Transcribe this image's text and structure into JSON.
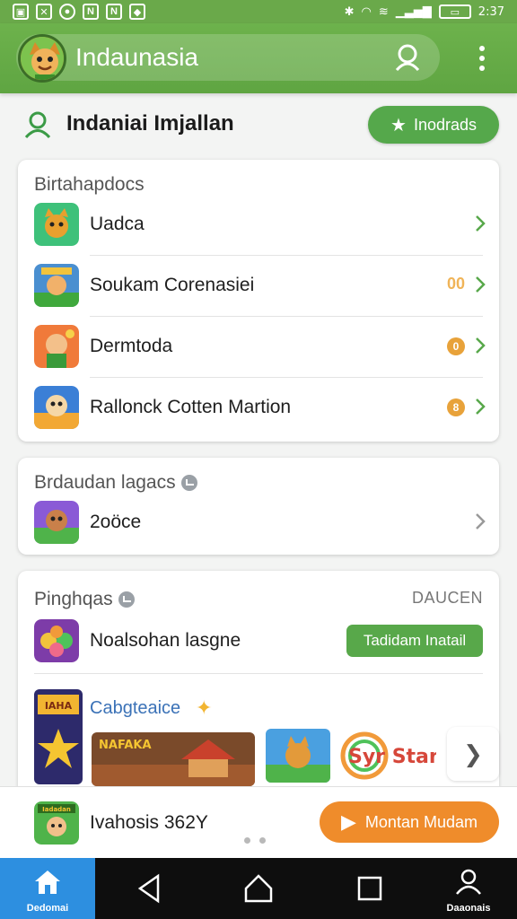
{
  "status_bar": {
    "time": "2:37",
    "left_icons": [
      "screenshot-icon",
      "x-icon",
      "circle-icon",
      "n-icon",
      "n-icon",
      "image-icon"
    ],
    "right_icons": [
      "bluetooth-icon",
      "wifi-icon",
      "signal-icon",
      "battery-icon"
    ]
  },
  "app_bar": {
    "title": "Indaunasia"
  },
  "header": {
    "title": "Indaniai Imjallan",
    "upgrade_label": "Inodrads"
  },
  "card1": {
    "title": "Birtahapdocs",
    "items": [
      {
        "label": "Uadca"
      },
      {
        "label": "Soukam Corenasiei",
        "badge": "00"
      },
      {
        "label": "Dermtoda",
        "badge": "0"
      },
      {
        "label": "Rallonck Cotten Martion",
        "badge": "8"
      }
    ]
  },
  "card2": {
    "title": "Brdaudan lagacs",
    "items": [
      {
        "label": "2oöce"
      }
    ]
  },
  "card3": {
    "title": "Pinghqas",
    "side_label": "DAUCEN",
    "item_label": "Noalsohan lasgne",
    "install_label": "Tadidam Inatail",
    "promo_title": "Cabgteaice",
    "promo_text_tile": "Syr Stan",
    "banner_text": "NAFAKA",
    "poster_text": "IAHA"
  },
  "bottom_promo": {
    "label": "Ivahosis 362Y",
    "button_label": "Montan Mudam",
    "thumb_text": "Iadadan"
  },
  "nav": {
    "home_label": "Dedomai",
    "profile_label": "Daaonais"
  },
  "colors": {
    "primary_green": "#5fa542",
    "accent_orange": "#ef8c2b",
    "home_blue": "#2d8fe0"
  }
}
